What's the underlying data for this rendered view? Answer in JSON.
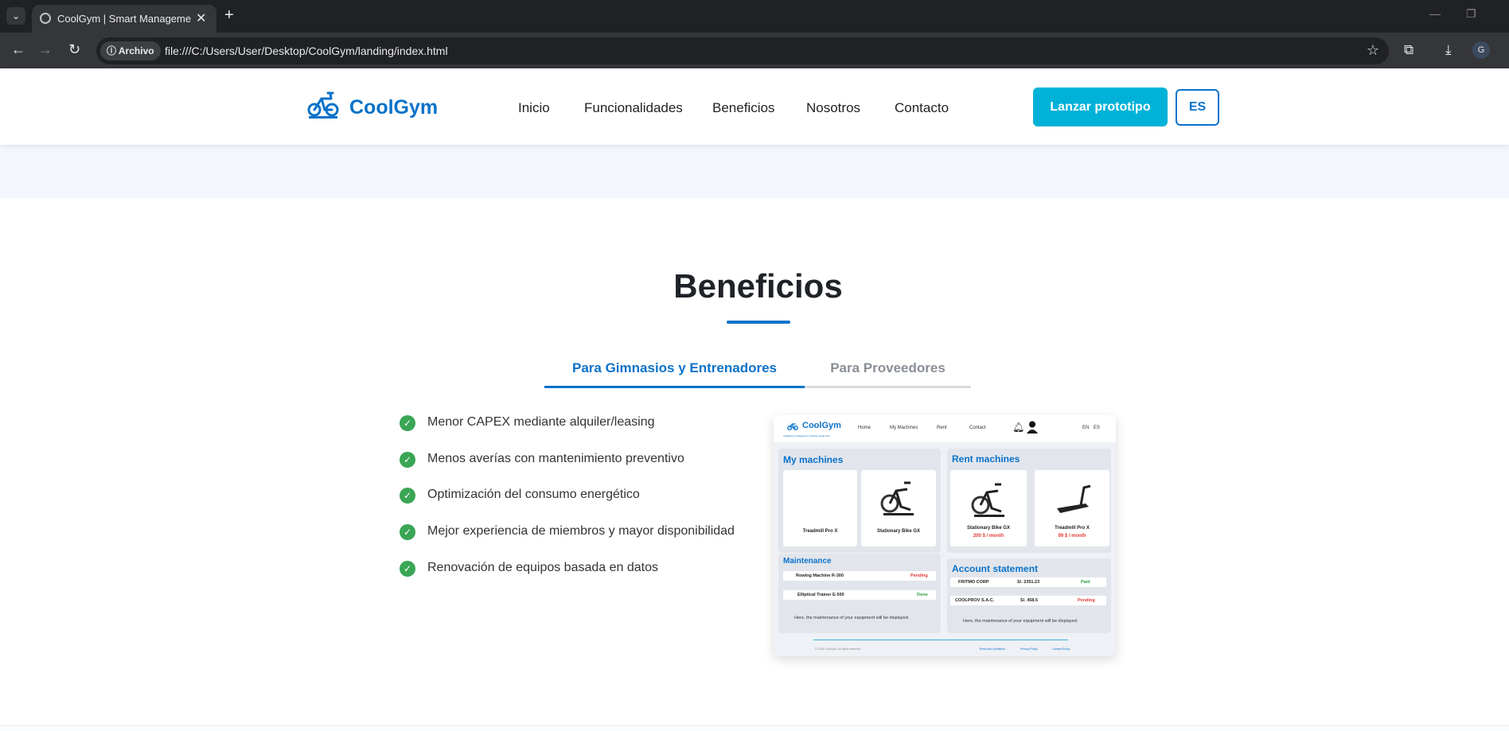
{
  "browser": {
    "tab_title": "CoolGym | Smart Management",
    "new_tab_symbol": "+",
    "close_symbol": "✕",
    "security_chip": "Archivo",
    "url": "file:///C:/Users/User/Desktop/CoolGym/landing/index.html",
    "profile_initial": "G"
  },
  "header": {
    "brand": "CoolGym",
    "nav": [
      "Inicio",
      "Funcionalidades",
      "Beneficios",
      "Nosotros",
      "Contacto"
    ],
    "cta_label": "Lanzar prototipo",
    "lang_label": "ES"
  },
  "benefits": {
    "title": "Beneficios",
    "tabs": [
      "Para Gimnasios y Entrenadores",
      "Para Proveedores"
    ],
    "active_tab": "Para Gimnasios y Entrenadores",
    "items": [
      "Menor CAPEX mediante alquiler/leasing",
      "Menos averías con mantenimiento preventivo",
      "Optimización del consumo energético",
      "Mejor experiencia de miembros y mayor disponibilidad",
      "Renovación de equipos basada en datos"
    ]
  },
  "mock": {
    "brand": "CoolGym",
    "tagline": "Intelligent management of fitness equipment",
    "nav": [
      "Home",
      "My Machines",
      "Rent",
      "Contact"
    ],
    "langs": [
      "EN",
      "ES"
    ],
    "my_machines": {
      "title": "My machines",
      "cards": [
        "Treadmill Pro X",
        "Stationary Bike GX"
      ]
    },
    "rent_machines": {
      "title": "Rent machines",
      "cards": [
        {
          "name": "Stationary Bike GX",
          "price": "200 $ / month"
        },
        {
          "name": "Treadmill Pro X",
          "price": "99 $ / month"
        }
      ]
    },
    "maintenance": {
      "title": "Maintenance",
      "rows": [
        {
          "name": "Rowing Machine R-300",
          "status": "Pending"
        },
        {
          "name": "Elliptical Trainer E-500",
          "status": "Done"
        }
      ],
      "note": "Here, the maintenance of your equipment will be displayed."
    },
    "account": {
      "title": "Account statement",
      "rows": [
        {
          "name": "FRITMO CORP",
          "amount": "S/. 2351.23",
          "status": "Paid"
        },
        {
          "name": "COOLPROV S.A.C.",
          "amount": "S/. 458.5",
          "status": "Pending"
        }
      ],
      "note": "Here, the maintenance of your equipment will be displayed."
    },
    "footer": {
      "copyright": "© 2025 CoolGym. All rights reserved.",
      "links": [
        "Terms and conditions",
        "Privacy Policy",
        "Contact Policy"
      ]
    }
  },
  "colors": {
    "brand": "#0b72c9",
    "cta": "#00b2d8",
    "check": "#3aa655",
    "pending": "#e53935",
    "done": "#2e9d44"
  }
}
